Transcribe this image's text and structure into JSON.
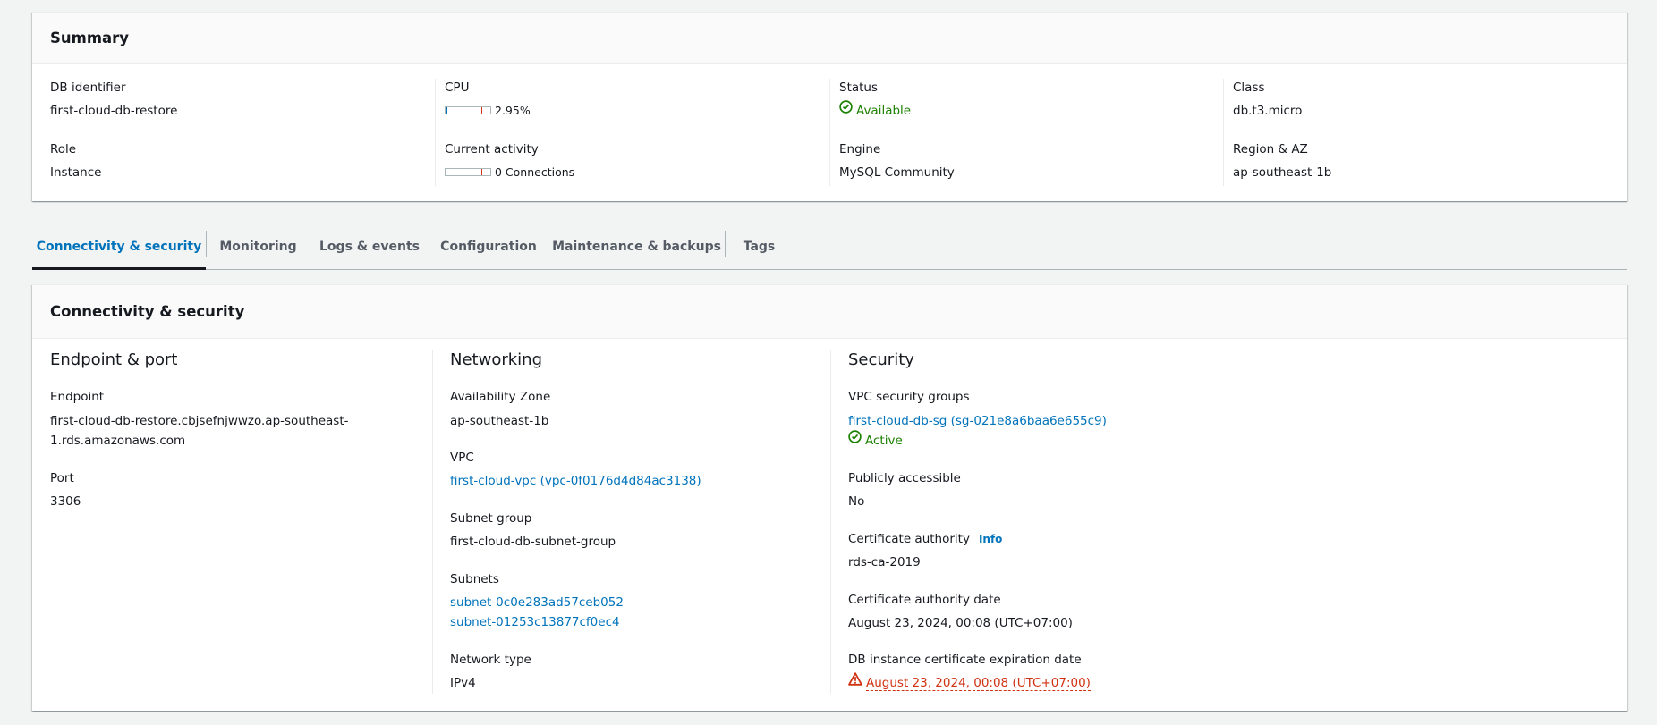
{
  "summary": {
    "title": "Summary",
    "db_identifier": {
      "label": "DB identifier",
      "value": "first-cloud-db-restore"
    },
    "role": {
      "label": "Role",
      "value": "Instance"
    },
    "cpu": {
      "label": "CPU",
      "value": "2.95%",
      "percent": 2.95,
      "threshold_percent": 80
    },
    "current_activity": {
      "label": "Current activity",
      "value": "0 Connections",
      "percent": 0,
      "threshold_percent": 80
    },
    "status": {
      "label": "Status",
      "value": "Available",
      "icon": "check-circle-icon"
    },
    "engine": {
      "label": "Engine",
      "value": "MySQL Community"
    },
    "class": {
      "label": "Class",
      "value": "db.t3.micro"
    },
    "region_az": {
      "label": "Region & AZ",
      "value": "ap-southeast-1b"
    }
  },
  "tabs": [
    {
      "label": "Connectivity & security",
      "active": true
    },
    {
      "label": "Monitoring",
      "active": false
    },
    {
      "label": "Logs & events",
      "active": false
    },
    {
      "label": "Configuration",
      "active": false
    },
    {
      "label": "Maintenance & backups",
      "active": false
    },
    {
      "label": "Tags",
      "active": false
    }
  ],
  "connectivity": {
    "title": "Connectivity & security",
    "endpoint_port": {
      "title": "Endpoint & port",
      "endpoint": {
        "label": "Endpoint",
        "value_line1": "first-cloud-db-restore.cbjsefnjwwzo.ap-southeast-",
        "value_line2": "1.rds.amazonaws.com"
      },
      "port": {
        "label": "Port",
        "value": "3306"
      }
    },
    "networking": {
      "title": "Networking",
      "availability_zone": {
        "label": "Availability Zone",
        "value": "ap-southeast-1b"
      },
      "vpc": {
        "label": "VPC",
        "value": "first-cloud-vpc (vpc-0f0176d4d84ac3138)"
      },
      "subnet_group": {
        "label": "Subnet group",
        "value": "first-cloud-db-subnet-group"
      },
      "subnets": {
        "label": "Subnets",
        "values": [
          "subnet-0c0e283ad57ceb052",
          "subnet-01253c13877cf0ec4"
        ]
      },
      "network_type": {
        "label": "Network type",
        "value": "IPv4"
      }
    },
    "security": {
      "title": "Security",
      "vpc_security_groups": {
        "label": "VPC security groups",
        "value": "first-cloud-db-sg (sg-021e8a6baa6e655c9)",
        "status": "Active"
      },
      "publicly_accessible": {
        "label": "Publicly accessible",
        "value": "No"
      },
      "certificate_authority": {
        "label": "Certificate authority",
        "info": "Info",
        "value": "rds-ca-2019"
      },
      "certificate_authority_date": {
        "label": "Certificate authority date",
        "value": "August 23, 2024, 00:08 (UTC+07:00)"
      },
      "cert_expiration": {
        "label": "DB instance certificate expiration date",
        "value": "August 23, 2024, 00:08 (UTC+07:00)",
        "icon": "warning-icon"
      }
    }
  },
  "colors": {
    "link": "#0073bb",
    "success": "#1d8102",
    "error": "#d13212",
    "background": "#f2f3f3"
  }
}
